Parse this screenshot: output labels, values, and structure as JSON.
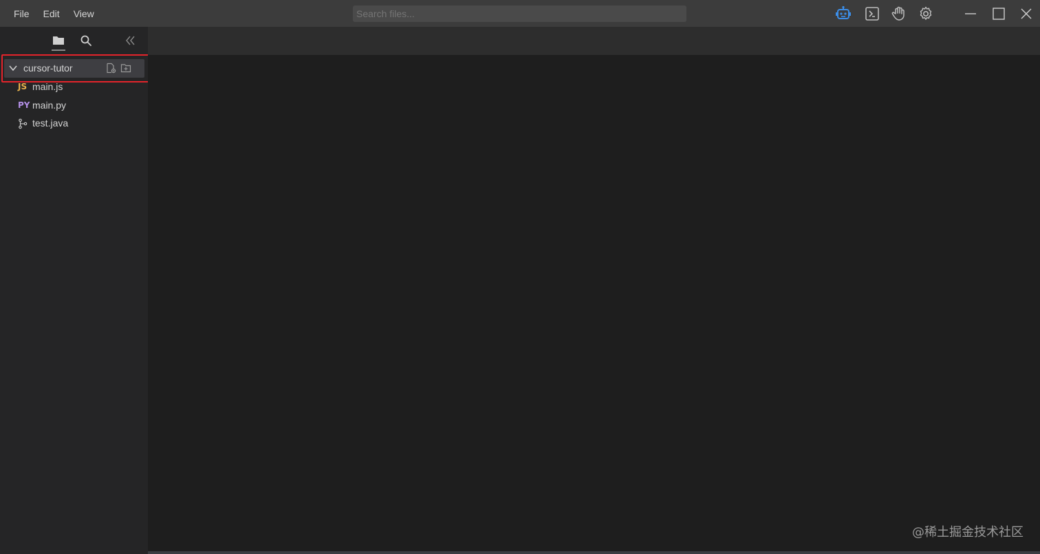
{
  "menu": {
    "items": [
      {
        "label": "File"
      },
      {
        "label": "Edit"
      },
      {
        "label": "View"
      }
    ]
  },
  "search": {
    "placeholder": "Search files..."
  },
  "toolbar": {
    "icons": [
      "robot-icon",
      "terminal-icon",
      "hand-icon",
      "gear-icon"
    ],
    "accent_color": "#3c8ee8"
  },
  "window_controls": [
    "minimize-icon",
    "maximize-icon",
    "close-icon"
  ],
  "sidebar": {
    "tabs": [
      "folder-icon",
      "search-icon"
    ],
    "collapse_icon": "double-chevron-left-icon",
    "root": {
      "label": "cursor-tutor",
      "actions": [
        "new-file-icon",
        "new-folder-icon"
      ]
    },
    "files": [
      {
        "badge": "JS",
        "name": "main.js"
      },
      {
        "badge": "PY",
        "name": "main.py"
      },
      {
        "badge": "",
        "name": "test.java",
        "icon": "git-branch-icon"
      }
    ],
    "highlight_color": "#e5242b"
  },
  "watermark": {
    "text": "@稀土掘金技术社区"
  }
}
